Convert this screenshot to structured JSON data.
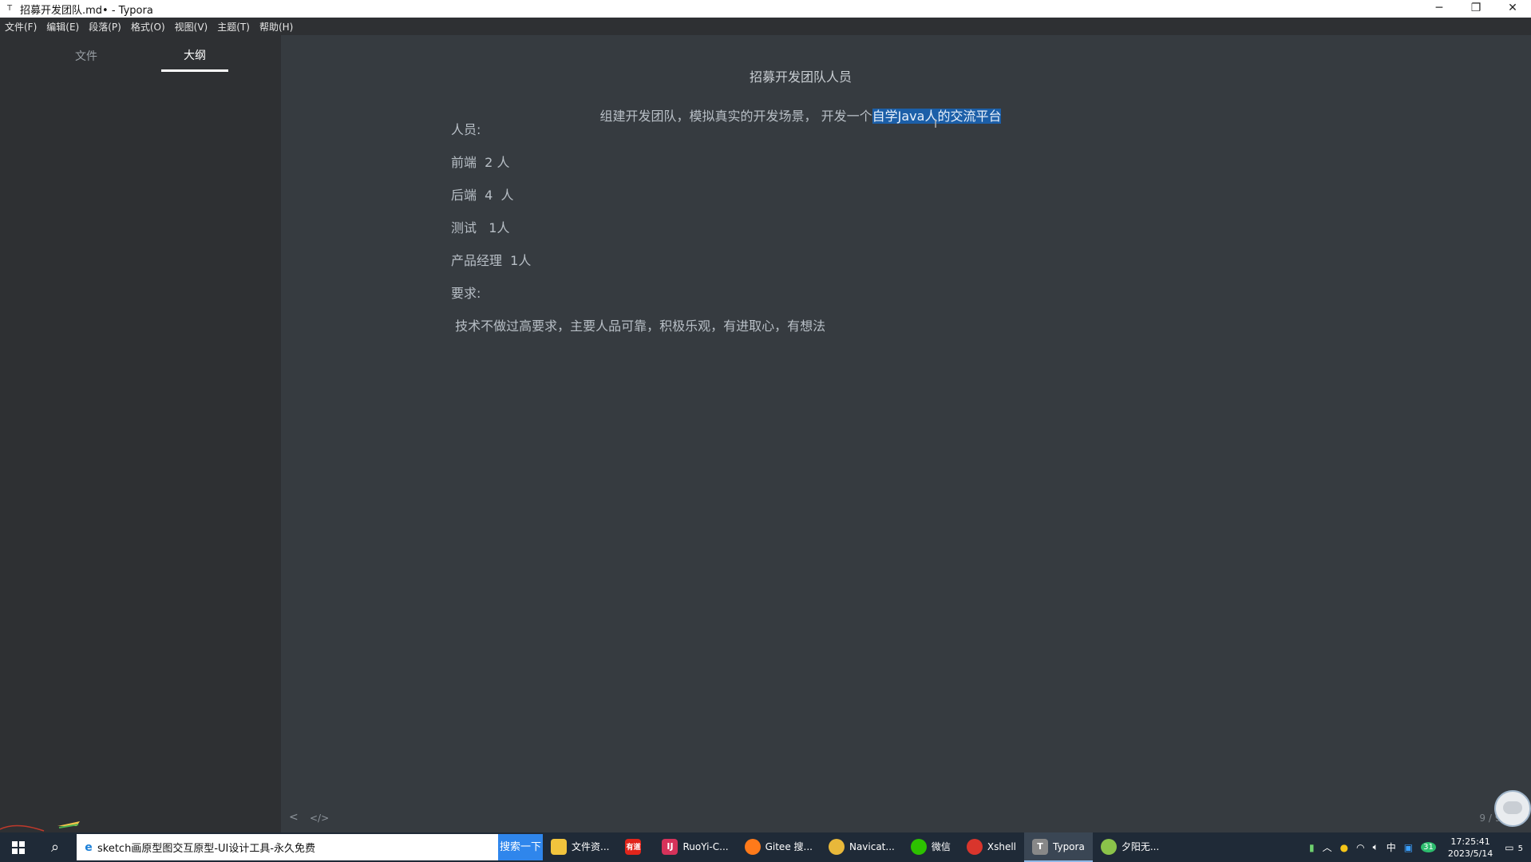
{
  "window": {
    "title": "招募开发团队.md• - Typora",
    "app_icon": "T"
  },
  "menu": [
    "文件(F)",
    "编辑(E)",
    "段落(P)",
    "格式(O)",
    "视图(V)",
    "主题(T)",
    "帮助(H)"
  ],
  "sidebar": {
    "tabs": [
      {
        "label": "文件",
        "active": false
      },
      {
        "label": "大纲",
        "active": true
      }
    ]
  },
  "document": {
    "title": "招募开发团队人员",
    "subtitle_plain": "组建开发团队，模拟真实的开发场景， 开发一个",
    "subtitle_selected": "自学Java人的交流平台",
    "paragraphs": [
      "人员:",
      "前端  2 人",
      "后端  4  人",
      "测试   1人",
      "产品经理  1人",
      "要求:",
      " 技术不做过高要求，主要人品可靠，积极乐观，有进取心，有想法"
    ]
  },
  "footer": {
    "prev_symbol": "<",
    "source_symbol": "</>",
    "word_count": "9 / 91"
  },
  "taskbar": {
    "search_text": "sketch画原型图交互原型-UI设计工具-永久免费",
    "search_button": "搜索一下",
    "tasks": [
      {
        "label": "文件资...",
        "icon_color": "#f2c43d",
        "icon_text": "",
        "active": false
      },
      {
        "label": "",
        "icon_color": "#e1251b",
        "icon_text": "有道",
        "active": false
      },
      {
        "label": "RuoYi-C...",
        "icon_color": "#d6325a",
        "icon_text": "IJ",
        "active": false
      },
      {
        "label": "Gitee 搜...",
        "icon_color": "#ff7a1a",
        "icon_text": "",
        "active": false
      },
      {
        "label": "Navicat...",
        "icon_color": "#e8b83a",
        "icon_text": "",
        "active": false
      },
      {
        "label": "微信",
        "icon_color": "#2dc100",
        "icon_text": "",
        "active": false
      },
      {
        "label": "Xshell",
        "icon_color": "#d9352c",
        "icon_text": "",
        "active": false
      },
      {
        "label": "Typora",
        "icon_color": "#888888",
        "icon_text": "T",
        "active": true
      },
      {
        "label": "夕阳无...",
        "icon_color": "#8bc34a",
        "icon_text": "",
        "active": false
      }
    ],
    "tray": {
      "ime": "中",
      "badge": "31",
      "time": "17:25:41",
      "date": "2023/5/14",
      "notifications": "5"
    }
  }
}
